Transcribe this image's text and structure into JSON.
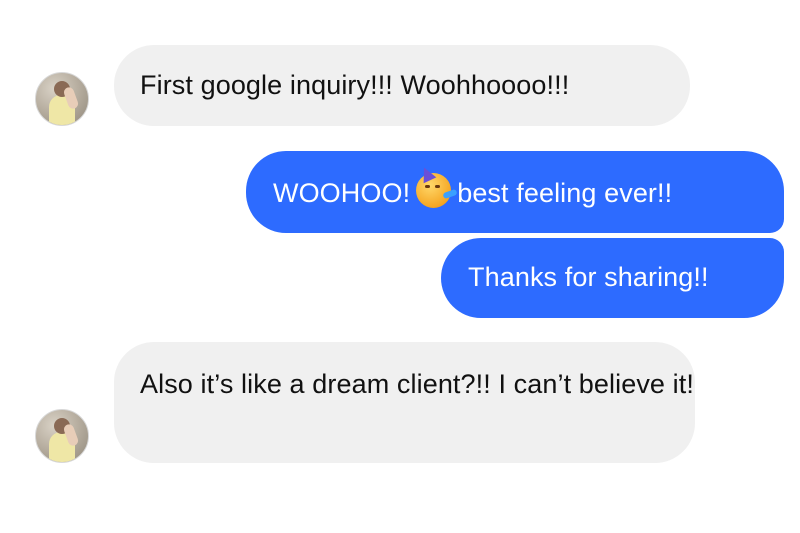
{
  "conversation": {
    "messages": [
      {
        "sender": "them",
        "text": "First google inquiry!!! Woohhoooo!!!"
      },
      {
        "sender": "me",
        "text_before": "WOOHOO!",
        "emoji": "partying-face",
        "text_after": "best feeling ever!!"
      },
      {
        "sender": "me",
        "text": "Thanks for sharing!!"
      },
      {
        "sender": "them",
        "text": "Also it’s like a dream client?!! I can’t believe it!"
      }
    ]
  },
  "colors": {
    "outgoing_bubble": "#2d6bff",
    "incoming_bubble": "#f0f0f0",
    "outgoing_text": "#ffffff",
    "incoming_text": "#111111",
    "background": "#ffffff"
  },
  "icons": {
    "avatar": "contact-avatar-photo",
    "emoji": "partying-face-emoji"
  }
}
